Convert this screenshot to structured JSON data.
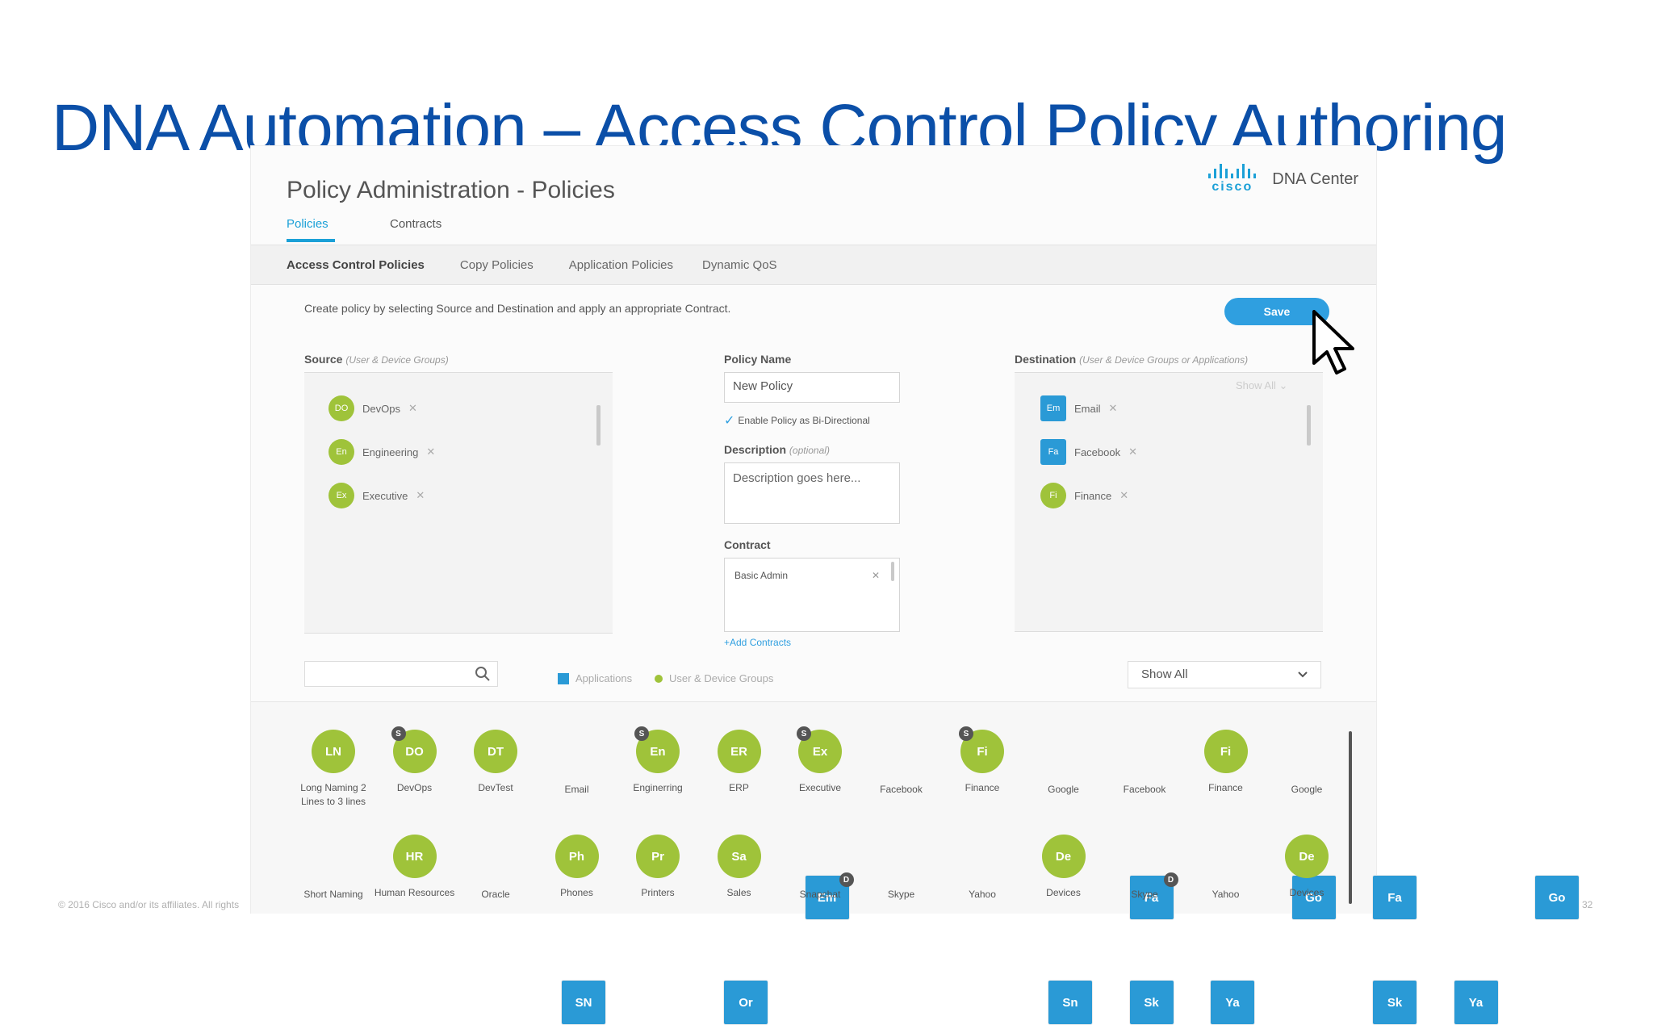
{
  "slide": {
    "title": "DNA Automation – Access Control Policy Authoring",
    "footer": "© 2016 Cisco and/or its affiliates. All rights",
    "page_number": "32"
  },
  "app": {
    "title": "Policy Administration - Policies",
    "brand_logo": "cisco",
    "brand_name": "DNA Center",
    "tabs": [
      {
        "label": "Policies",
        "active": true
      },
      {
        "label": "Contracts",
        "active": false
      }
    ],
    "subnav": [
      "Access Control Policies",
      "Copy Policies",
      "Application Policies",
      "Dynamic QoS"
    ],
    "instructions": "Create policy by selecting Source and Destination and apply an appropriate Contract.",
    "save_label": "Save",
    "source": {
      "label": "Source",
      "hint": "(User & Device Groups)",
      "items": [
        {
          "abbr": "DO",
          "name": "DevOps",
          "type": "group"
        },
        {
          "abbr": "En",
          "name": "Engineering",
          "type": "group"
        },
        {
          "abbr": "Ex",
          "name": "Executive",
          "type": "group"
        }
      ]
    },
    "policy": {
      "name_label": "Policy Name",
      "name_value": "New Policy",
      "bidirectional_label": "Enable Policy as Bi-Directional",
      "bidirectional_checked": true,
      "description_label": "Description",
      "description_hint": "(optional)",
      "description_placeholder": "Description goes here...",
      "contract_label": "Contract",
      "contract_value": "Basic Admin",
      "add_contracts": "+Add Contracts"
    },
    "destination": {
      "label": "Destination",
      "hint": "(User & Device Groups or Applications)",
      "show_all": "Show All",
      "items": [
        {
          "abbr": "Em",
          "name": "Email",
          "type": "app"
        },
        {
          "abbr": "Fa",
          "name": "Facebook",
          "type": "app"
        },
        {
          "abbr": "Fi",
          "name": "Finance",
          "type": "group"
        }
      ]
    },
    "legend": {
      "applications": "Applications",
      "groups": "User & Device Groups"
    },
    "filter_select": "Show All",
    "palette_row1": [
      {
        "abbr": "LN",
        "label": "Long Naming 2 Lines to 3 lines",
        "type": "group",
        "badge": ""
      },
      {
        "abbr": "DO",
        "label": "DevOps",
        "type": "group",
        "badge": "S"
      },
      {
        "abbr": "DT",
        "label": "DevTest",
        "type": "group",
        "badge": ""
      },
      {
        "abbr": "Em",
        "label": "Email",
        "type": "app",
        "badge": "D"
      },
      {
        "abbr": "En",
        "label": "Enginerring",
        "type": "group",
        "badge": "S"
      },
      {
        "abbr": "ER",
        "label": "ERP",
        "type": "group",
        "badge": ""
      },
      {
        "abbr": "Ex",
        "label": "Executive",
        "type": "group",
        "badge": "S"
      },
      {
        "abbr": "Fa",
        "label": "Facebook",
        "type": "app",
        "badge": "D"
      },
      {
        "abbr": "Fi",
        "label": "Finance",
        "type": "group",
        "badge": "S"
      },
      {
        "abbr": "Go",
        "label": "Google",
        "type": "app",
        "badge": ""
      },
      {
        "abbr": "Fa",
        "label": "Facebook",
        "type": "app",
        "badge": ""
      },
      {
        "abbr": "Fi",
        "label": "Finance",
        "type": "group",
        "badge": ""
      },
      {
        "abbr": "Go",
        "label": "Google",
        "type": "app",
        "badge": ""
      }
    ],
    "palette_row2": [
      {
        "abbr": "SN",
        "label": "Short Naming",
        "type": "app"
      },
      {
        "abbr": "HR",
        "label": "Human Resources",
        "type": "group"
      },
      {
        "abbr": "Or",
        "label": "Oracle",
        "type": "app"
      },
      {
        "abbr": "Ph",
        "label": "Phones",
        "type": "group"
      },
      {
        "abbr": "Pr",
        "label": "Printers",
        "type": "group"
      },
      {
        "abbr": "Sa",
        "label": "Sales",
        "type": "group"
      },
      {
        "abbr": "Sn",
        "label": "Snapchat",
        "type": "app"
      },
      {
        "abbr": "Sk",
        "label": "Skype",
        "type": "app"
      },
      {
        "abbr": "Ya",
        "label": "Yahoo",
        "type": "app"
      },
      {
        "abbr": "De",
        "label": "Devices",
        "type": "group"
      },
      {
        "abbr": "Sk",
        "label": "Skype",
        "type": "app"
      },
      {
        "abbr": "Ya",
        "label": "Yahoo",
        "type": "app"
      },
      {
        "abbr": "De",
        "label": "Devices",
        "type": "group"
      }
    ],
    "colors": {
      "title_blue": "#0b4fa8",
      "accent": "#2f9fe0",
      "app_blue": "#2a9ad6",
      "group_green": "#9fc33a"
    }
  }
}
